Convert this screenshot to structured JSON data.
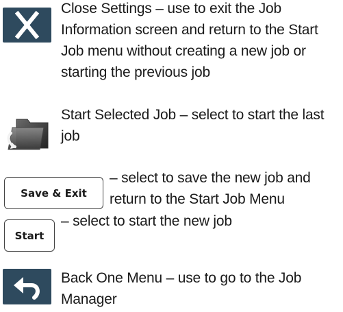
{
  "items": [
    {
      "icon": "close-icon",
      "text": "Close Settings – use to exit the Job\nInformation screen and return to the Start\nJob menu without creating a new job or\nstarting the previous job"
    },
    {
      "icon": "folder-start-icon",
      "text": "Start Selected Job – select to start the last\njob"
    },
    {
      "icon": "button",
      "button_label": "Save & Exit",
      "text": "– select to save the new job and\nreturn to the Start Job Menu"
    },
    {
      "icon": "button",
      "button_label": "Start",
      "text": "– select to start the new job"
    },
    {
      "icon": "back-arrow-icon",
      "text": "Back One Menu – use to go to the Job\nManager"
    }
  ],
  "colors": {
    "tile": "#2e4a5e",
    "text": "#1a1a1a"
  }
}
